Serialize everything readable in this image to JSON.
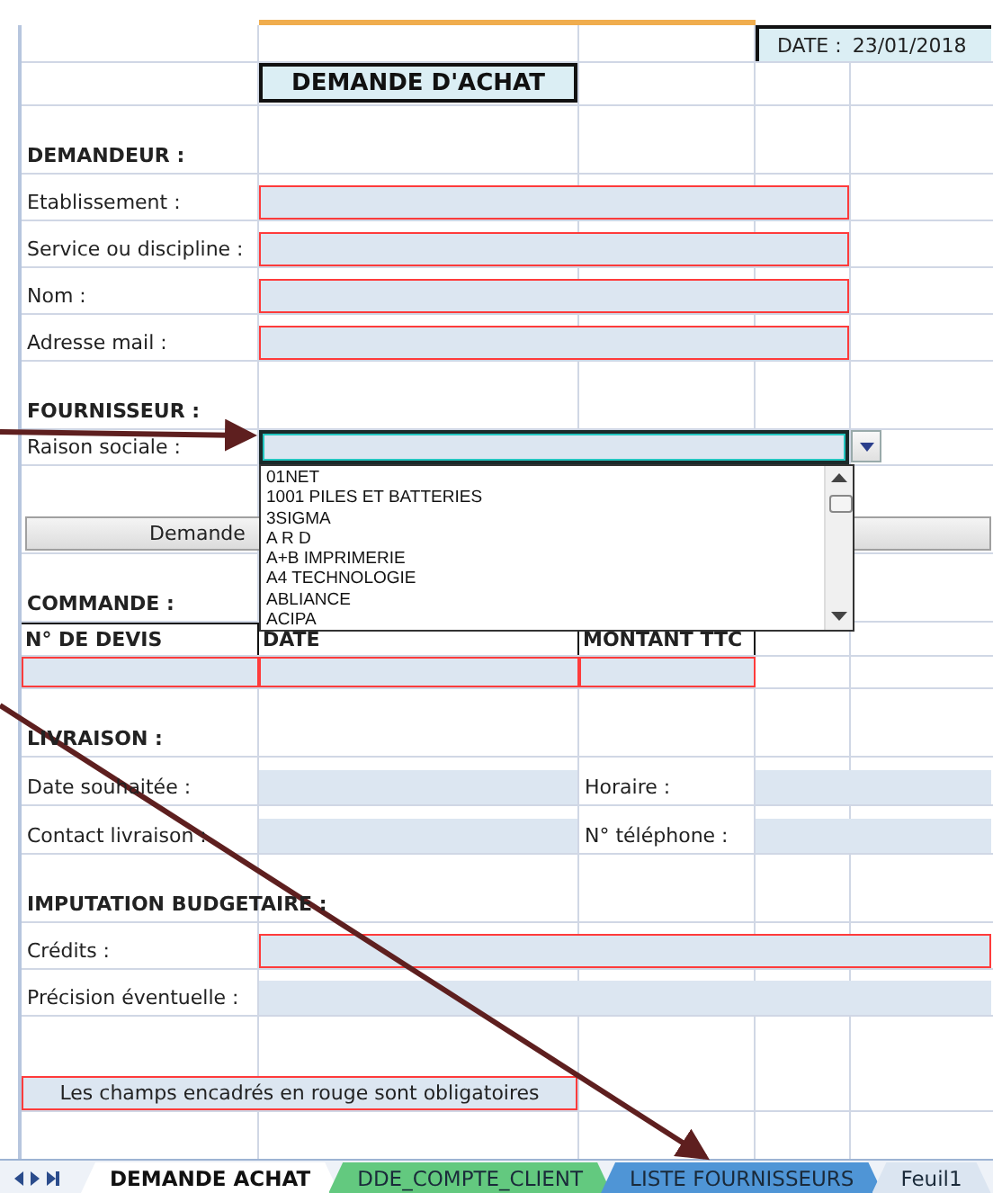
{
  "rows": [
    {
      "kind": "date",
      "label": "DATE :",
      "value": "23/01/2018"
    },
    {
      "kind": "title",
      "text": "DEMANDE D'ACHAT"
    },
    {
      "kind": "heading",
      "text": "DEMANDEUR :"
    },
    {
      "kind": "field",
      "label": "Etablissement :",
      "required": true,
      "full_width": false
    },
    {
      "kind": "field",
      "label": "Service ou discipline :",
      "required": true,
      "full_width": false
    },
    {
      "kind": "field",
      "label": "Nom :",
      "required": true,
      "full_width": false
    },
    {
      "kind": "field",
      "label": "Adresse mail :",
      "required": true,
      "full_width": false
    },
    {
      "kind": "heading",
      "text": "FOURNISSEUR :"
    },
    {
      "kind": "combo",
      "label": "Raison sociale :",
      "focused": true,
      "options": [
        "01NET",
        "1001 PILES ET BATTERIES",
        "3SIGMA",
        "A R D",
        "A+B IMPRIMERIE",
        "A4 TECHNOLOGIE",
        "ABLIANCE",
        "ACIPA"
      ]
    },
    {
      "kind": "button",
      "text": "Demande"
    },
    {
      "kind": "heading",
      "text": "COMMANDE :"
    },
    {
      "kind": "table_header",
      "columns": [
        "N° DE DEVIS",
        "DATE",
        "MONTANT TTC"
      ]
    },
    {
      "kind": "table_row",
      "required": true
    },
    {
      "kind": "heading",
      "text": "LIVRAISON :"
    },
    {
      "kind": "pair",
      "label": "Date souhaitée :",
      "label_2": "Horaire :"
    },
    {
      "kind": "pair",
      "label": "Contact livraison :",
      "label_2": "N° téléphone :"
    },
    {
      "kind": "heading",
      "text": "IMPUTATION BUDGETAIRE :"
    },
    {
      "kind": "field",
      "label": "Crédits :",
      "required": true,
      "full_width": true
    },
    {
      "kind": "field",
      "label": "Précision éventuelle :",
      "required": false,
      "full_width": true
    },
    {
      "kind": "note",
      "text": "Les champs encadrés en rouge sont obligatoires",
      "required": true
    }
  ],
  "sheet_tabs": [
    {
      "label": "DEMANDE ACHAT",
      "selected": true,
      "color": "#ffffff"
    },
    {
      "label": "DDE_COMPTE_CLIENT",
      "selected": false,
      "color": "#63c97f"
    },
    {
      "label": "LISTE FOURNISSEURS",
      "selected": false,
      "color": "#4f95d6"
    },
    {
      "label": "Feuil1",
      "selected": false,
      "color": "#dbe5f1"
    }
  ]
}
